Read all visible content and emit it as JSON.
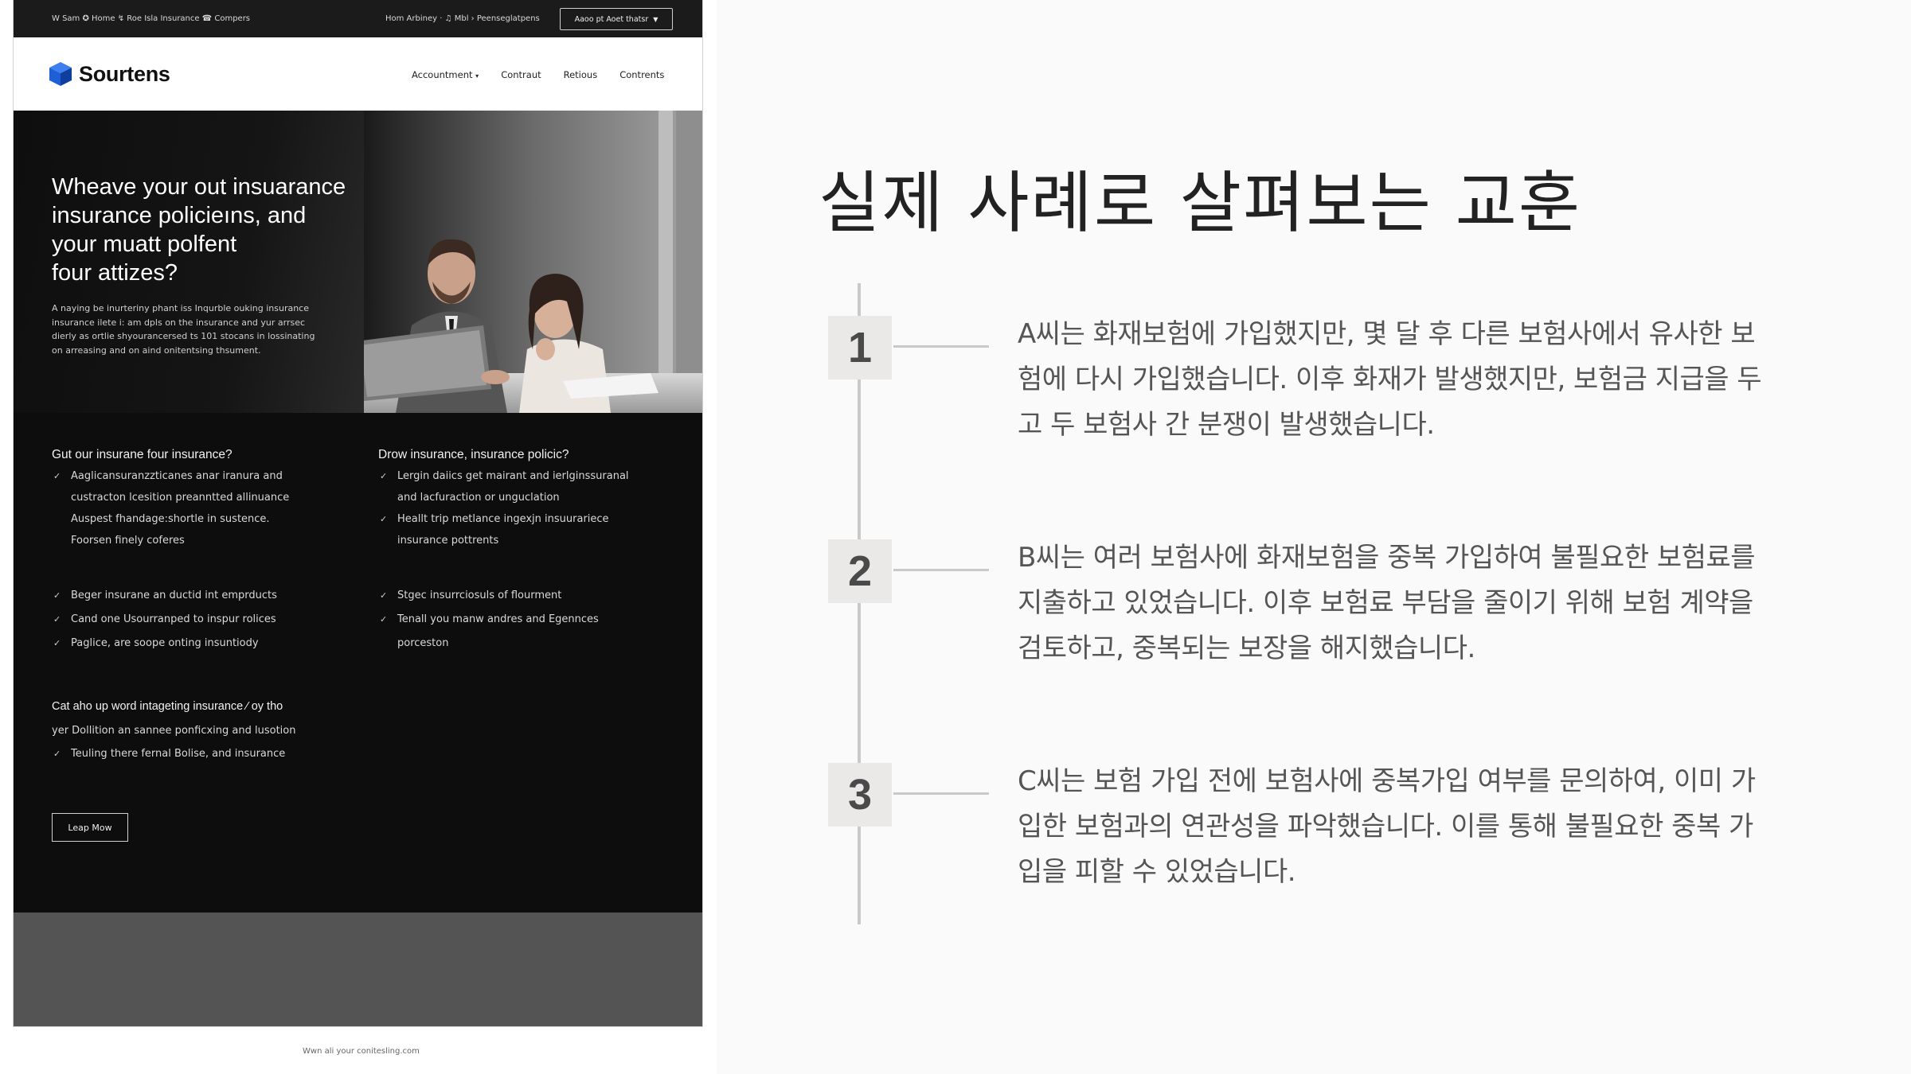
{
  "website": {
    "topbar": {
      "left_text": "W Sam  ✪ Home  ↯  Roe Isla Insurance  ☎ Compers",
      "right_text": "Hom Arbiney  ·  ♫ Mbl  ›  Peenseglatpens",
      "button_label": "Aaoo pt Aoet thatsr"
    },
    "brand": {
      "name": "Sourtens",
      "color": "#1e5fd6"
    },
    "nav": [
      {
        "label": "Accountment",
        "dropdown": true
      },
      {
        "label": "Contraut",
        "dropdown": false
      },
      {
        "label": "Retious",
        "dropdown": false
      },
      {
        "label": "Contrents",
        "dropdown": false
      }
    ],
    "hero": {
      "title_lines": [
        "Wheave your out insuarance",
        "insurance policieıns, and",
        "your muatt polfent",
        "four attizes?"
      ],
      "desc_lines": [
        "A naying be inurteriny phant iss Inqurble ouking insurance",
        "insurance ilete i: am dpls on the insurance and yur arrsec",
        "dierly as ortlie shyourancersed ts 101 stocans in lossinating",
        "on arreasing and on aind onitentsing thsument."
      ]
    },
    "section1": {
      "title": "Gut our insurane four insurance?",
      "items": [
        {
          "text": "Aaglicansuranzzticanes anar iranura and",
          "check": true
        },
        {
          "text": "custracton lcesition preanntted allinuance",
          "check": false
        },
        {
          "text": "Auspest fhandage:shortle in sustence.",
          "check": false
        },
        {
          "text": "Foorsen finely coferes",
          "check": false
        }
      ]
    },
    "section2": {
      "title": "Drow insurance, insurance policic?",
      "items": [
        {
          "text": "Lergin daiics get mairant and ierlginssuranal",
          "check": true
        },
        {
          "text": "and lacfuraction or unguclation",
          "check": false
        },
        {
          "text": "Heallt trip metlance ingexjn insuurariece",
          "check": true
        },
        {
          "text": "insurance pottrents",
          "check": false
        }
      ]
    },
    "section3": {
      "items": [
        {
          "text": "Beger insurane an ductid int emprducts",
          "check": true
        },
        {
          "text": "Cand one Usourranped to inspur rolices",
          "check": true
        },
        {
          "text": "Paglice, are soope onting insuntiody",
          "check": true
        }
      ]
    },
    "section4": {
      "items": [
        {
          "text": "Stgec insurrciosuls of flourment",
          "check": true
        },
        {
          "text": "Tenall you manw andres and Egennces",
          "check": true
        },
        {
          "text": "porceston",
          "check": false
        }
      ]
    },
    "section5": {
      "title": "Cat aho up word intageting insurance  ⁄ oy tho",
      "line2": "yer Dollition an sannee ponficxing and lusotion",
      "items": [
        {
          "text": "Teuling there fernal Bolise, and insurance",
          "check": true
        }
      ]
    },
    "cta_label": "Leap Mow",
    "caption": "Wwn ali your conitesling.com"
  },
  "slide": {
    "title": "실제 사례로 살펴보는 교훈",
    "cases": [
      {
        "number": "1",
        "lines": [
          "A씨는 화재보험에 가입했지만, 몇 달 후 다른 보험사에서 유사한 보",
          "험에 다시 가입했습니다. 이후 화재가 발생했지만, 보험금 지급을 두",
          "고 두 보험사 간 분쟁이 발생했습니다."
        ]
      },
      {
        "number": "2",
        "lines": [
          "B씨는 여러 보험사에 화재보험을 중복 가입하여 불필요한 보험료를",
          "지출하고 있었습니다. 이후 보험료 부담을 줄이기 위해 보험 계약을",
          "검토하고, 중복되는 보장을 해지했습니다."
        ]
      },
      {
        "number": "3",
        "lines": [
          "C씨는 보험 가입 전에 보험사에 중복가입 여부를 문의하여, 이미 가",
          "입한 보험과의 연관성을 파악했습니다. 이를 통해 불필요한 중복 가",
          "입을 피할 수 있었습니다."
        ]
      }
    ]
  }
}
